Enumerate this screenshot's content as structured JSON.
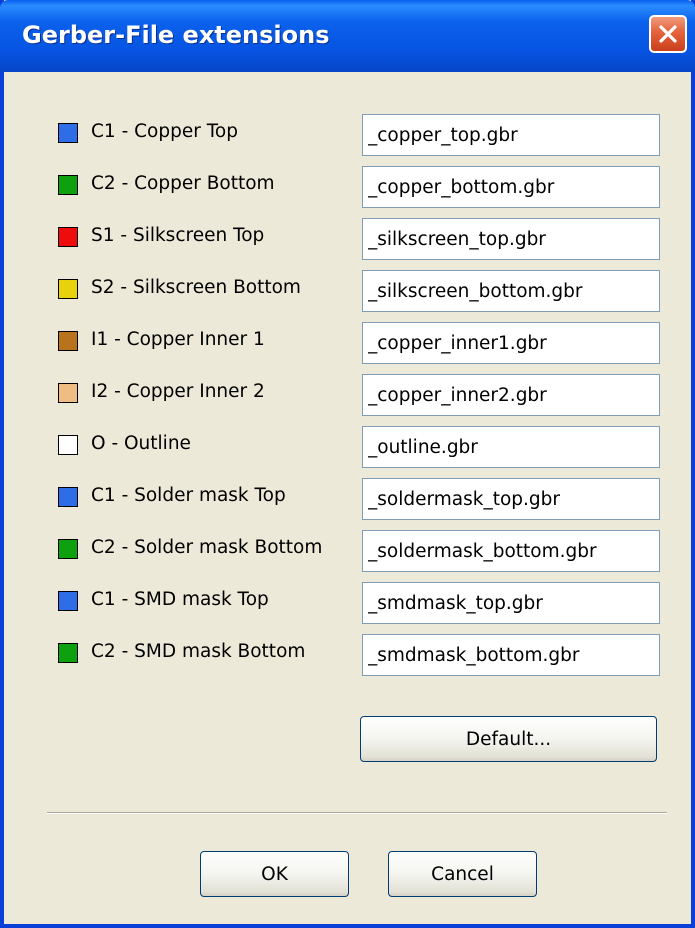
{
  "window": {
    "title": "Gerber-File extensions"
  },
  "colors": {
    "blue": "#2f6de6",
    "green": "#0fa010",
    "red": "#ee0c0c",
    "yellow": "#e8d20e",
    "brown": "#b8731c",
    "tan": "#efbc84",
    "white": "#ffffff"
  },
  "layers": [
    {
      "label": "C1 - Copper Top",
      "value": "_copper_top.gbr",
      "color": "#2f6de6"
    },
    {
      "label": "C2 - Copper Bottom",
      "value": "_copper_bottom.gbr",
      "color": "#0fa010"
    },
    {
      "label": "S1 - Silkscreen Top",
      "value": "_silkscreen_top.gbr",
      "color": "#ee0c0c"
    },
    {
      "label": "S2 - Silkscreen Bottom",
      "value": "_silkscreen_bottom.gbr",
      "color": "#e8d20e"
    },
    {
      "label": "I1 - Copper Inner 1",
      "value": "_copper_inner1.gbr",
      "color": "#b8731c"
    },
    {
      "label": "I2 - Copper Inner 2",
      "value": "_copper_inner2.gbr",
      "color": "#efbc84"
    },
    {
      "label": "O - Outline",
      "value": "_outline.gbr",
      "color": "#ffffff"
    },
    {
      "label": "C1 - Solder mask Top",
      "value": "_soldermask_top.gbr",
      "color": "#2f6de6"
    },
    {
      "label": "C2 - Solder mask Bottom",
      "value": "_soldermask_bottom.gbr",
      "color": "#0fa010"
    },
    {
      "label": "C1 - SMD mask Top",
      "value": "_smdmask_top.gbr",
      "color": "#2f6de6"
    },
    {
      "label": "C2 - SMD mask Bottom",
      "value": "_smdmask_bottom.gbr",
      "color": "#0fa010"
    }
  ],
  "buttons": {
    "default_label": "Default...",
    "ok_label": "OK",
    "cancel_label": "Cancel"
  },
  "icons": {
    "close": "close-icon"
  }
}
